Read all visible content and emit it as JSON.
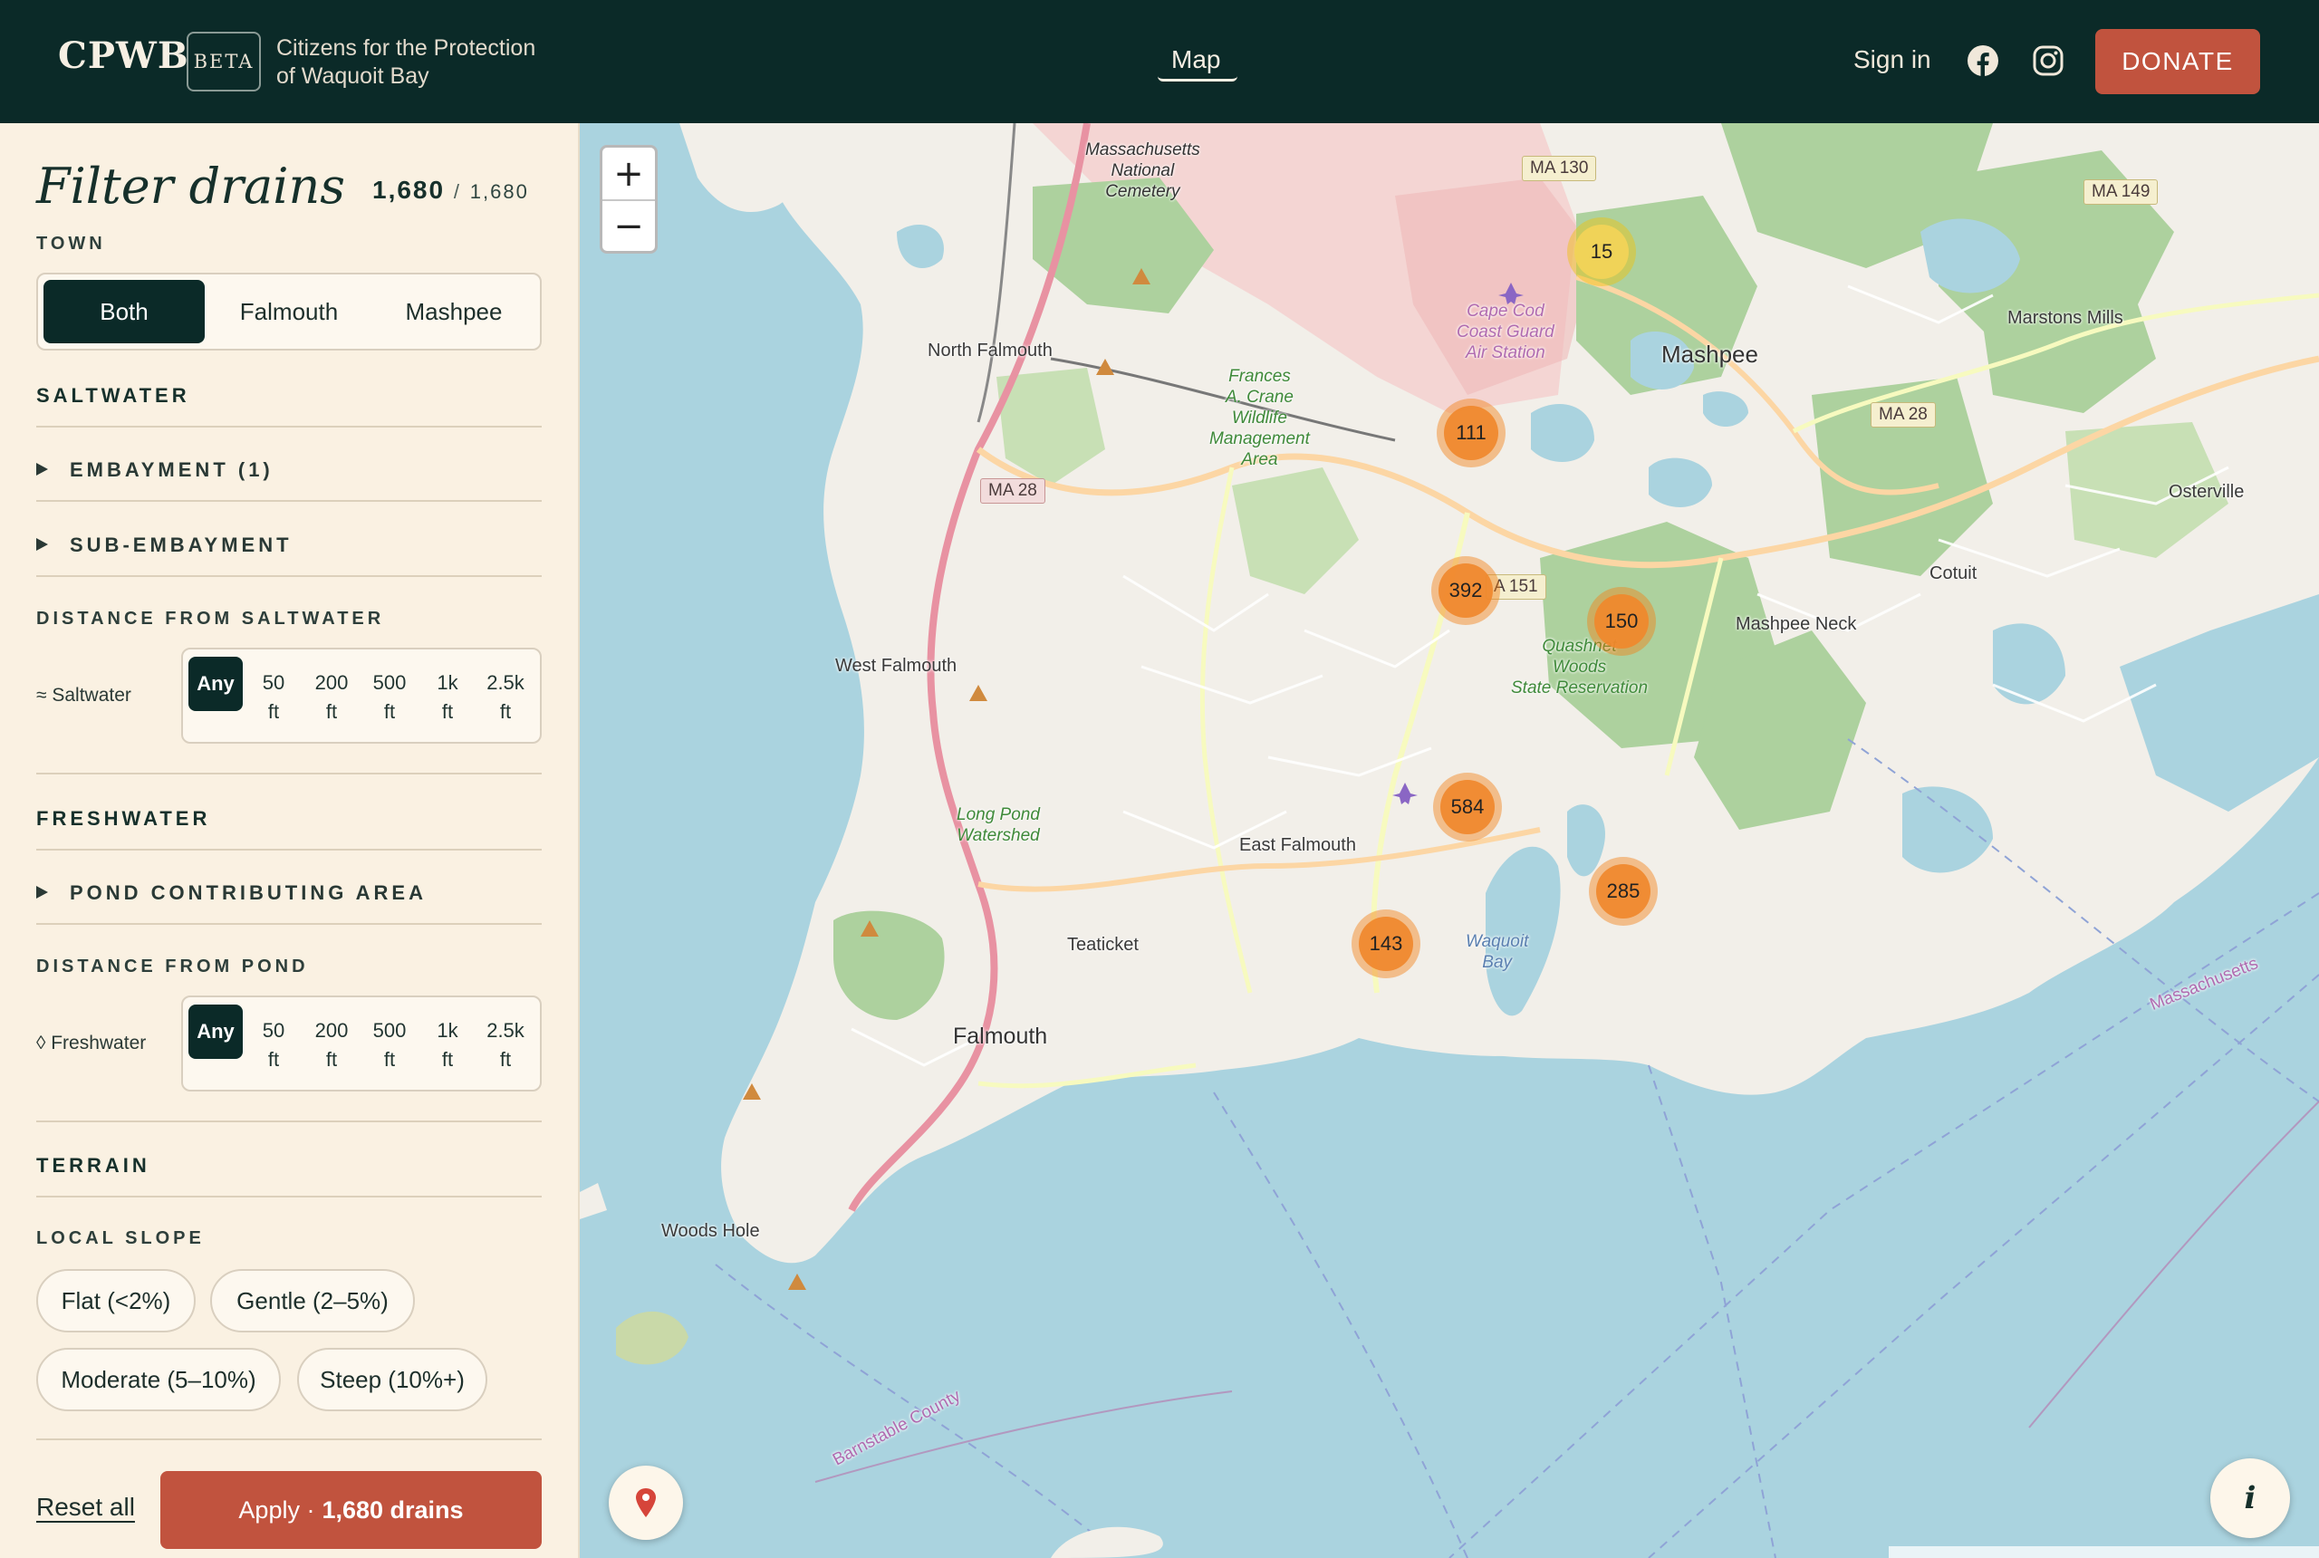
{
  "header": {
    "logo": "CPWB",
    "beta": "BETA",
    "org_line1": "Citizens for the Protection",
    "org_line2": "of Waquoit Bay",
    "nav_map": "Map",
    "sign_in": "Sign in",
    "donate": "DONATE",
    "icons": [
      "facebook-icon",
      "instagram-icon"
    ]
  },
  "sidebar": {
    "title": "Filter drains",
    "count_shown": "1,680",
    "count_sep": "/",
    "count_total": "1,680",
    "town_label": "TOWN",
    "town_options": [
      "Both",
      "Falmouth",
      "Mashpee"
    ],
    "town_selected": "Both",
    "saltwater_heading": "SALTWATER",
    "embayment": "EMBAYMENT (1)",
    "sub_embayment": "SUB-EMBAYMENT",
    "dist_salt_label": "DISTANCE FROM SALTWATER",
    "salt_row_label": "≈ Saltwater",
    "freshwater_heading": "FRESHWATER",
    "pond_area": "POND CONTRIBUTING AREA",
    "dist_pond_label": "DISTANCE FROM POND",
    "fresh_row_label": "◊ Freshwater",
    "distance_options": [
      {
        "top": "Any",
        "bottom": ""
      },
      {
        "top": "50",
        "bottom": "ft"
      },
      {
        "top": "200",
        "bottom": "ft"
      },
      {
        "top": "500",
        "bottom": "ft"
      },
      {
        "top": "1k",
        "bottom": "ft"
      },
      {
        "top": "2.5k",
        "bottom": "ft"
      }
    ],
    "terrain_heading": "TERRAIN",
    "local_slope_label": "LOCAL SLOPE",
    "slope_options": [
      "Flat (<2%)",
      "Gentle (2–5%)",
      "Moderate (5–10%)",
      "Steep (10%+)"
    ],
    "reset": "Reset all",
    "apply_prefix": "Apply ·",
    "apply_count": "1,680 drains"
  },
  "map": {
    "zoom_in": "+",
    "zoom_out": "−",
    "info": "i",
    "clusters": [
      {
        "count": "15",
        "level": "low"
      },
      {
        "count": "111",
        "level": "high"
      },
      {
        "count": "392",
        "level": "high"
      },
      {
        "count": "150",
        "level": "high"
      },
      {
        "count": "584",
        "level": "high"
      },
      {
        "count": "285",
        "level": "high"
      },
      {
        "count": "143",
        "level": "high"
      }
    ],
    "labels": {
      "mass_cemetery": "Massachusetts\nNational\nCemetery",
      "ma130": "MA 130",
      "ma149": "MA 149",
      "ma28a": "MA 28",
      "ma28b": "MA 28",
      "a151": "A 151",
      "coast_guard": "Cape Cod\nCoast Guard\nAir Station",
      "mashpee": "Mashpee",
      "marstons": "Marstons Mills",
      "north_falmouth": "North Falmouth",
      "crane": "Frances\nA. Crane\nWildlife\nManagement\nArea",
      "osterville": "Osterville",
      "cotuit": "Cotuit",
      "mashpee_neck": "Mashpee Neck",
      "quashnet": "Quashnet\nWoods\nState Reservation",
      "west_falmouth": "West Falmouth",
      "long_pond": "Long Pond\nWatershed",
      "east_falmouth": "East Falmouth",
      "teaticket": "Teaticket",
      "waquoit_bay": "Waquoit\nBay",
      "falmouth": "Falmouth",
      "woods_hole": "Woods Hole",
      "barnstable_county": "Barnstable County",
      "massachusetts": "Massachusetts"
    }
  },
  "colors": {
    "header_bg": "#0b2a28",
    "accent": "#c1533e",
    "sidebar_bg": "#faf1e2",
    "water": "#aad3df",
    "land": "#f2efe9",
    "cluster_orange": "#f0882c",
    "cluster_yellow": "#f1d357"
  }
}
